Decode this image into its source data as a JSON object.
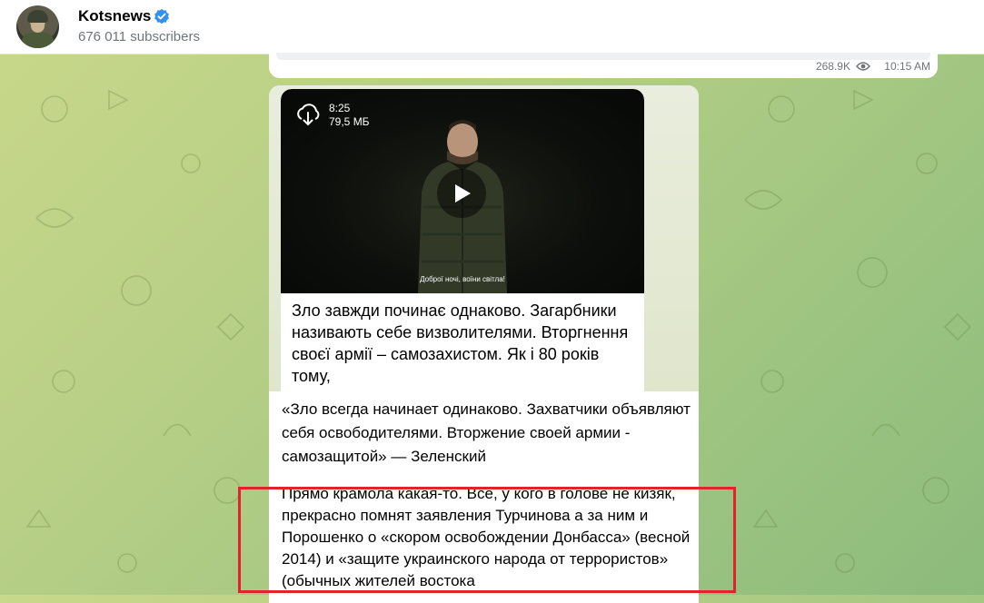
{
  "channel": {
    "name": "Kotsnews",
    "subscribers": "676 011 subscribers"
  },
  "previous_post": {
    "views": "268.9K",
    "time": "10:15 AM"
  },
  "post": {
    "video": {
      "duration": "8:25",
      "size": "79,5 МБ",
      "subtitle": "Доброї ночі, воїни світла!"
    },
    "quoted_text": "Зло завжди починає однаково. Загарбники називають себе визволителями. Вторгнення своєї армії – самозахистом. Як і 80 років тому,",
    "translation": "«Зло всегда начинает одинаково. Захватчики объявляют себя освободителями. Вторжение своей армии - самозащитой» — Зеленский",
    "comment": "Прямо крамола какая-то. Все, у кого в голове не кизяк, прекрасно помнят заявления Турчинова а за ним и Порошенко о «скором освобождении Донбасса» (весной 2014) и «защите украинского народа от террористов» (обычных жителей востока"
  },
  "colors": {
    "verified": "#3390ec",
    "highlight": "#e3232c",
    "secondary_text": "#707579"
  },
  "icons": [
    "verified-icon",
    "eye-icon",
    "download-icon",
    "play-icon"
  ]
}
